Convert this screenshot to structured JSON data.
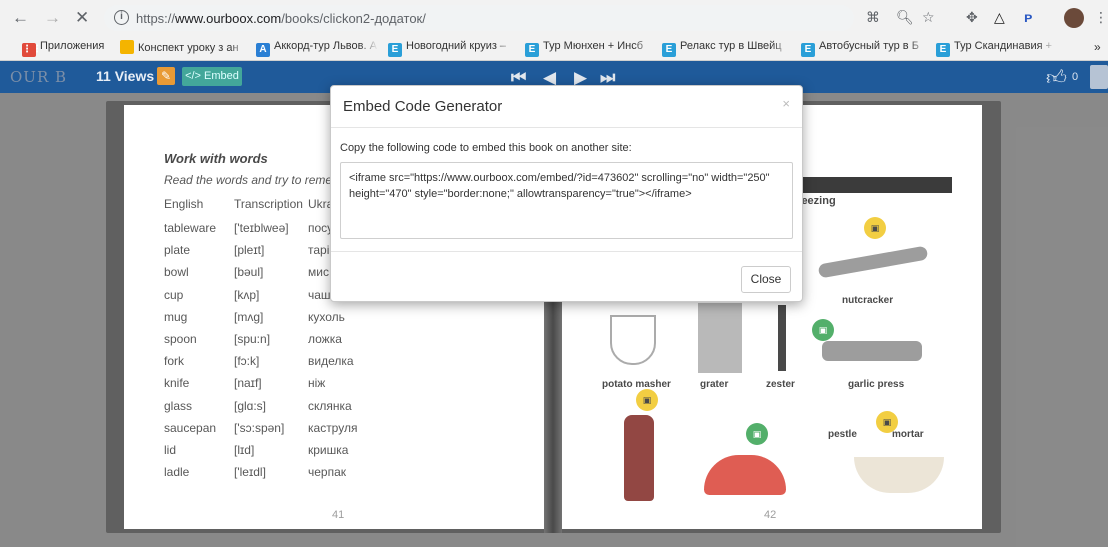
{
  "browser": {
    "url_prefix": "https://",
    "url_domain": "www.ourboox.com",
    "url_path": "/books/clickon2-додаток/",
    "nav": {
      "back": "←",
      "forward": "→",
      "stop": "✕",
      "info": "i"
    },
    "extensions": [
      "⌘",
      "🔍︎",
      "☆",
      "✥",
      "△",
      "ᴘ",
      "⋮"
    ]
  },
  "bookmarks": [
    {
      "label": "Приложения",
      "icon": "apps-icon",
      "color": "#e14a3b"
    },
    {
      "label": "Конспект уроку з ан",
      "icon": "globe-icon",
      "color": "#f4b400"
    },
    {
      "label": "Аккорд-тур Львов. А",
      "icon": "a-icon",
      "color": "#2a7fd4"
    },
    {
      "label": "Новогодний круиз –",
      "icon": "e-icon",
      "color": "#2a9fd8"
    },
    {
      "label": "Тур Мюнхен + Инсб",
      "icon": "e-icon",
      "color": "#2a9fd8"
    },
    {
      "label": "Релакс тур в Швейц",
      "icon": "e-icon",
      "color": "#2a9fd8"
    },
    {
      "label": "Автобусный тур в Б",
      "icon": "e-icon",
      "color": "#2a9fd8"
    },
    {
      "label": "Тур Скандинавия +",
      "icon": "e-icon",
      "color": "#2a9fd8"
    }
  ],
  "bookmarks_more": "»",
  "site": {
    "logo": "OUR B",
    "views": "11 Views",
    "embed": "</> Embed",
    "pager": {
      "first": "⏮",
      "prev": "◀",
      "next": "▶",
      "last": "⏭"
    },
    "likes": "0"
  },
  "left_page": {
    "title": "Work with words",
    "instruction": "Read the words and try to reme",
    "headers": [
      "English",
      "Transcription",
      "Ukra"
    ],
    "rows": [
      [
        "tableware",
        "['teɪblweə]",
        "посу"
      ],
      [
        "plate",
        "[pleɪt]",
        "тарі"
      ],
      [
        "bowl",
        "[bəul]",
        "мис"
      ],
      [
        "cup",
        "[kʌp]",
        "чаш"
      ],
      [
        "mug",
        "[mʌg]",
        "кухоль"
      ],
      [
        "spoon",
        "[spu:n]",
        "ложка"
      ],
      [
        "fork",
        "[fɔ:k]",
        "виделка"
      ],
      [
        "knife",
        "[naɪf]",
        "ніж"
      ],
      [
        "glass",
        "[glɑ:s]",
        "склянка"
      ],
      [
        "saucepan",
        "['sɔ:spən]",
        "каструля"
      ],
      [
        "lid",
        "[lɪd]",
        "кришка"
      ],
      [
        "ladle",
        "['leɪdl]",
        "черпак"
      ]
    ],
    "page_number": "41"
  },
  "right_page": {
    "section": "queezing",
    "labels": [
      "nutcracker",
      "potato masher",
      "grater",
      "zester",
      "garlic press",
      "pestle",
      "mortar"
    ],
    "page_number": "42"
  },
  "modal": {
    "title": "Embed Code Generator",
    "close_x": "×",
    "instruction": "Copy the following code to embed this book on another site:",
    "code": "<iframe src=\"https://www.ourboox.com/embed/?id=473602\" scrolling=\"no\" width=\"250\" height=\"470\" style=\"border:none;\" allowtransparency=\"true\"></iframe>",
    "close_button": "Close"
  }
}
